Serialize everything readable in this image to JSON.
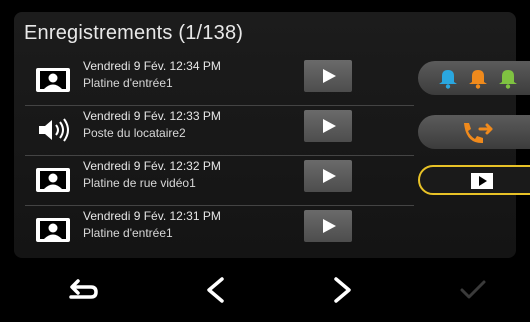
{
  "header": {
    "title": "Enregistrements (1/138)"
  },
  "recordings": [
    {
      "type": "video",
      "date": "Vendredi 9 Fév. 12:34 PM",
      "source": "Platine d'entrée1"
    },
    {
      "type": "audio",
      "date": "Vendredi 9 Fév. 12:33 PM",
      "source": "Poste du locataire2"
    },
    {
      "type": "video",
      "date": "Vendredi 9 Fév. 12:32 PM",
      "source": "Platine de rue vidéo1"
    },
    {
      "type": "video",
      "date": "Vendredi 9 Fév. 12:31 PM",
      "source": "Platine d'entrée1"
    }
  ],
  "side_buttons": [
    {
      "icon": "bells-icon",
      "colors": [
        "#2aa7e0",
        "#f08a1c",
        "#7fc241"
      ]
    },
    {
      "icon": "transfer-call-icon",
      "color": "#f08a1c"
    },
    {
      "icon": "video-play-icon",
      "selected": true,
      "border": "#e8c227"
    }
  ],
  "nav": {
    "icons": [
      "back-icon",
      "previous-icon",
      "next-icon",
      "confirm-icon"
    ],
    "confirm_disabled": true
  }
}
